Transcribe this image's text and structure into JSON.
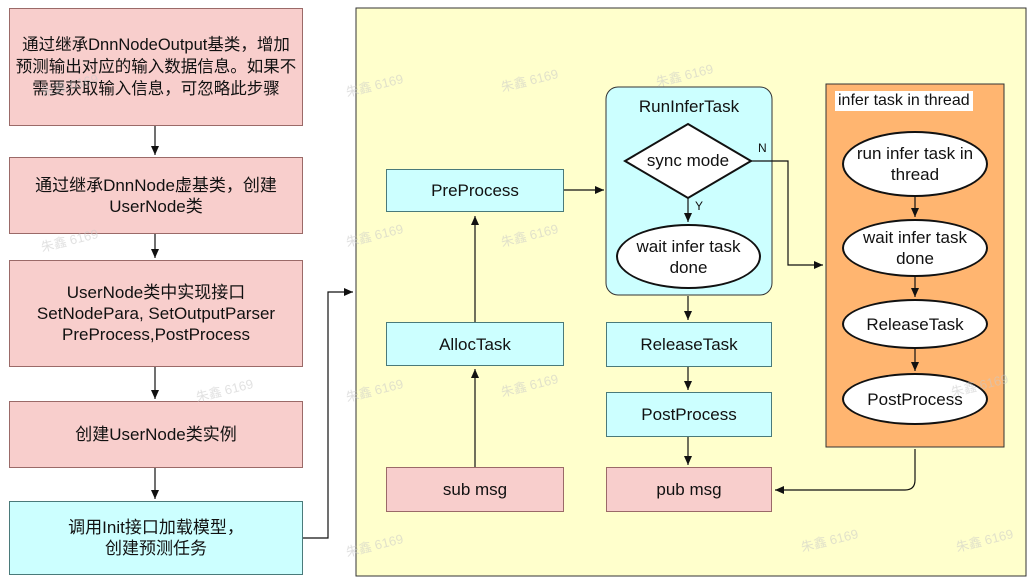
{
  "left_steps": [
    "通过继承DnnNodeOutput基类，增加预测输出对应的输入数据信息。如果不需要获取输入信息，可忽略此步骤",
    "通过继承DnnNode虚基类，创建UserNode类",
    "UserNode类中实现接口\nSetNodePara, SetOutputParser\nPreProcess,PostProcess",
    "创建UserNode类实例",
    "调用Init接口加载模型，\n创建预测任务"
  ],
  "flow": {
    "sub_msg": "sub msg",
    "alloc_task": "AllocTask",
    "preprocess": "PreProcess",
    "run_infer_task": "RunInferTask",
    "sync_mode": "sync mode",
    "no_label": "N",
    "yes_label": "Y",
    "wait_infer_task_done_sync": "wait infer task done",
    "release_task": "ReleaseTask",
    "post_process": "PostProcess",
    "pub_msg": "pub msg"
  },
  "thread": {
    "title": "infer task in thread",
    "run_infer_task": "run infer task in thread",
    "wait_infer_task_done": "wait infer task done",
    "release_task": "ReleaseTask",
    "post_process": "PostProcess"
  },
  "watermark": "朱鑫 6169",
  "colors": {
    "pink": "#f8cecc",
    "cyan": "#ccffff",
    "yellow_panel": "#ffffcc",
    "orange_panel": "#ffb570"
  }
}
